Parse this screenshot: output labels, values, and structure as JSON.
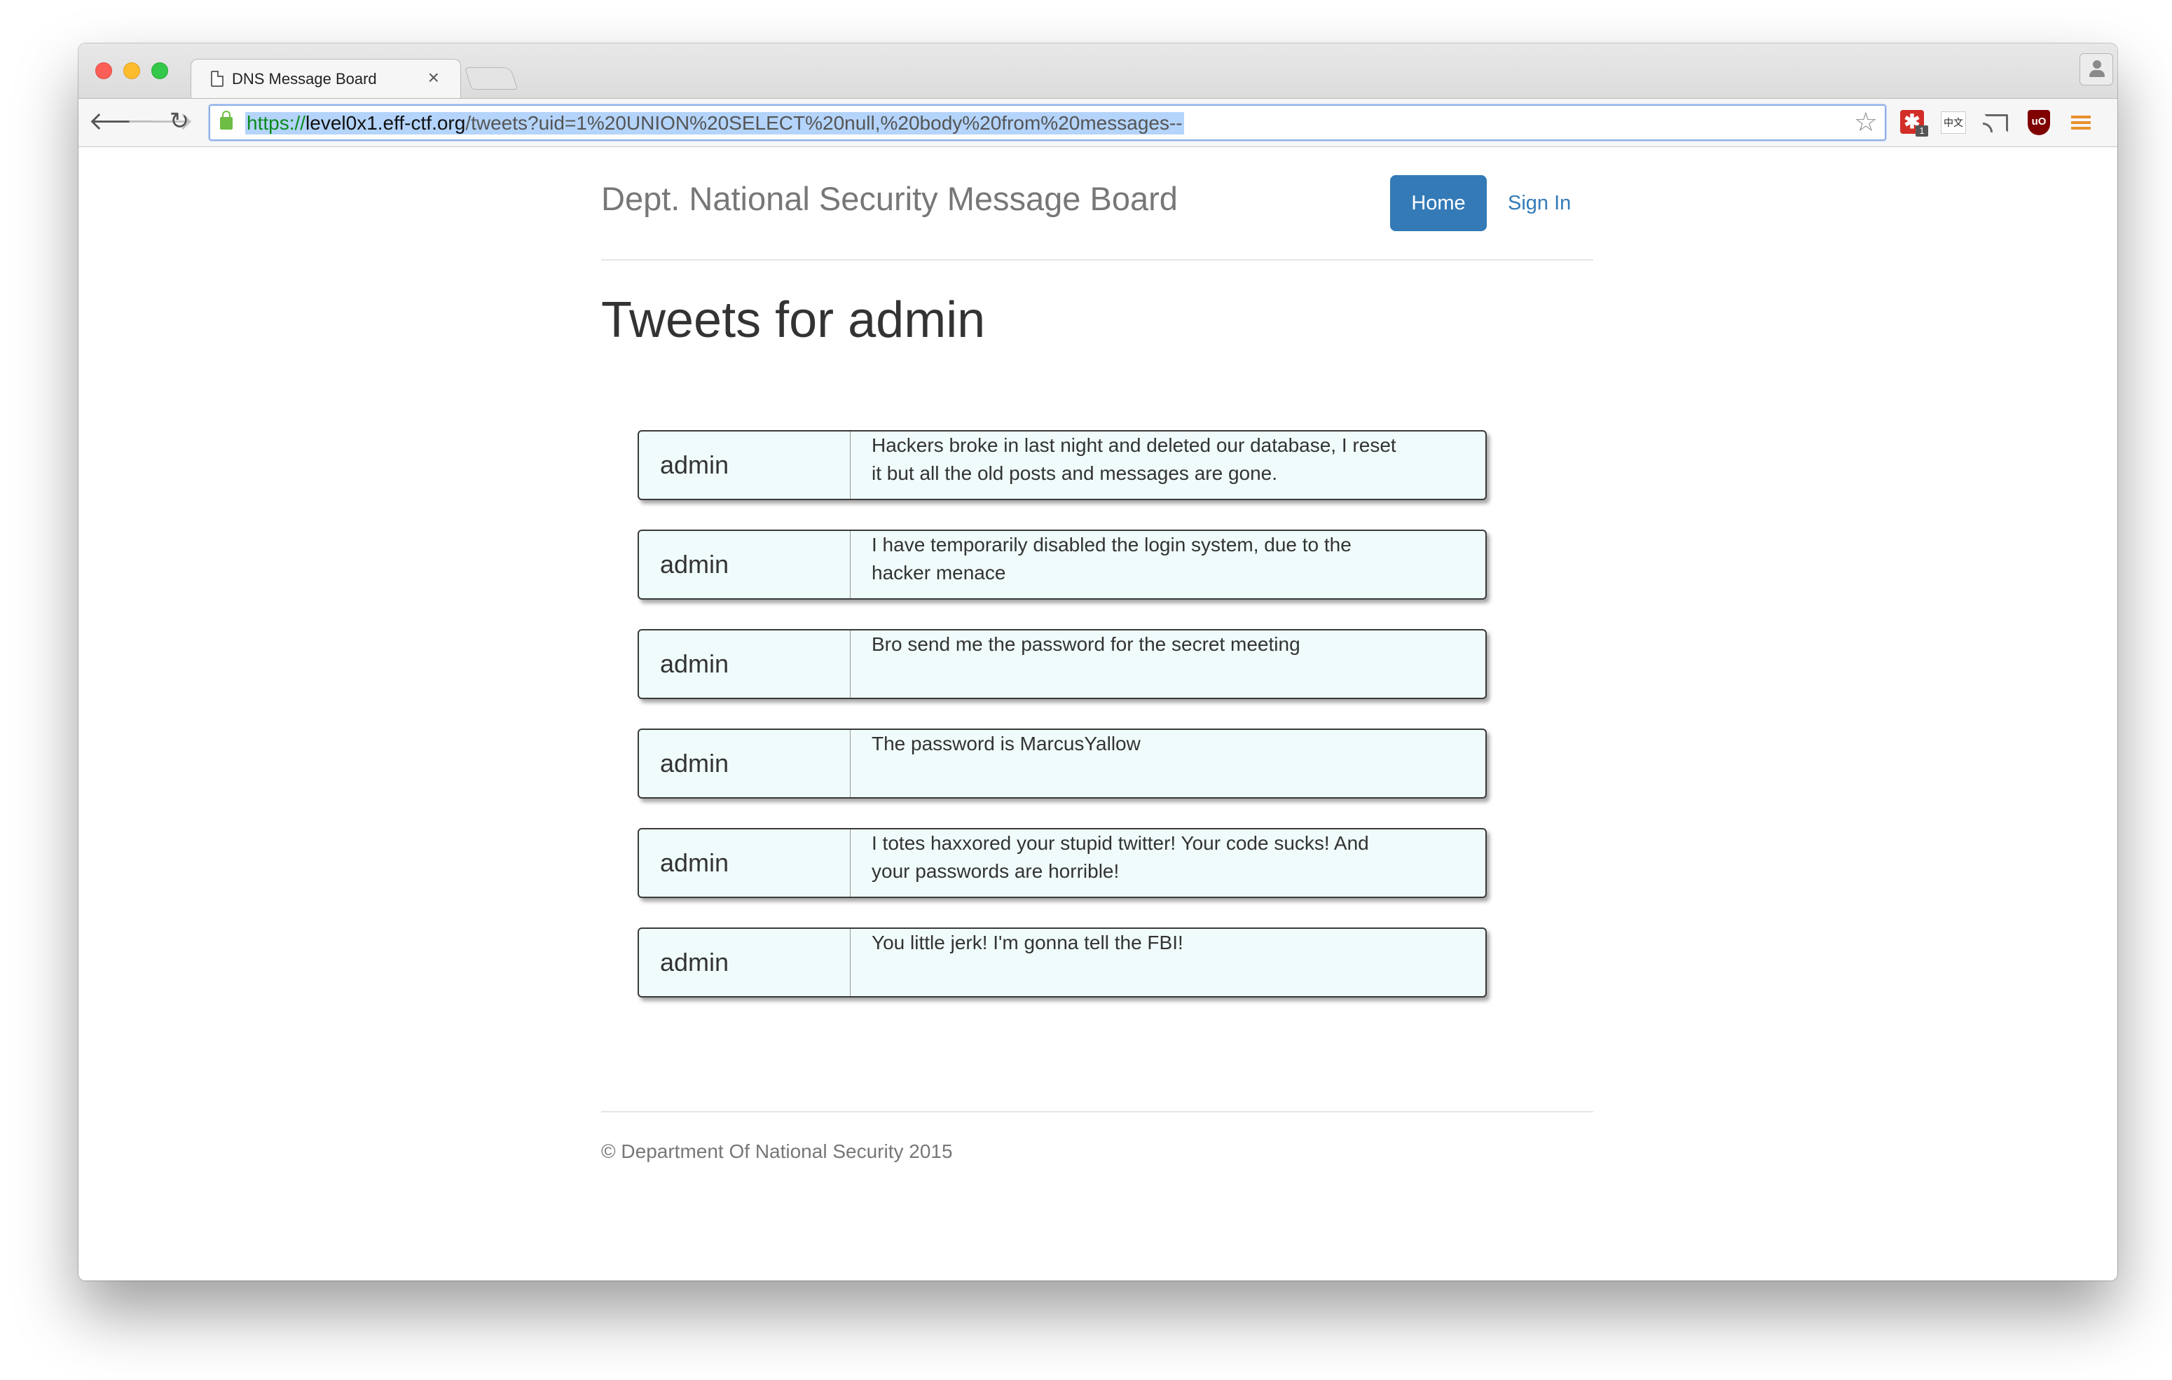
{
  "browser": {
    "tab_title": "DNS Message Board",
    "tab_close": "×",
    "url_scheme": "https://",
    "url_host": "level0x1.eff-ctf.org",
    "url_path": "/tweets?uid=1%20UNION%20SELECT%20null,%20body%20from%20messages--",
    "nav_back": "🡐",
    "nav_forward": "🡒",
    "nav_reload": "↻",
    "star": "☆",
    "ext_lastpass": "✱",
    "ext_lastpass_badge": "1",
    "ext_dict": "中文",
    "ext_ublock": "uO"
  },
  "header": {
    "brand": "Dept. National Security Message Board",
    "nav_home": "Home",
    "nav_signin": "Sign In"
  },
  "main": {
    "title": "Tweets for admin",
    "tweets": [
      {
        "user": "admin",
        "body": "Hackers broke in last night and deleted our database, I reset it but all the old posts and messages are gone."
      },
      {
        "user": "admin",
        "body": "I have temporarily disabled the login system, due to the hacker menace"
      },
      {
        "user": "admin",
        "body": "Bro send me the password for the secret meeting"
      },
      {
        "user": "admin",
        "body": "The password is MarcusYallow"
      },
      {
        "user": "admin",
        "body": "I totes haxxored your stupid twitter! Your code sucks! And your passwords are horrible!"
      },
      {
        "user": "admin",
        "body": "You little jerk! I'm gonna tell the FBI!"
      }
    ]
  },
  "footer": {
    "text": "© Department Of National Security 2015"
  },
  "colors": {
    "primary": "#337ab7",
    "tweet_bg": "#f0fbfb",
    "brand_text": "#777777"
  }
}
